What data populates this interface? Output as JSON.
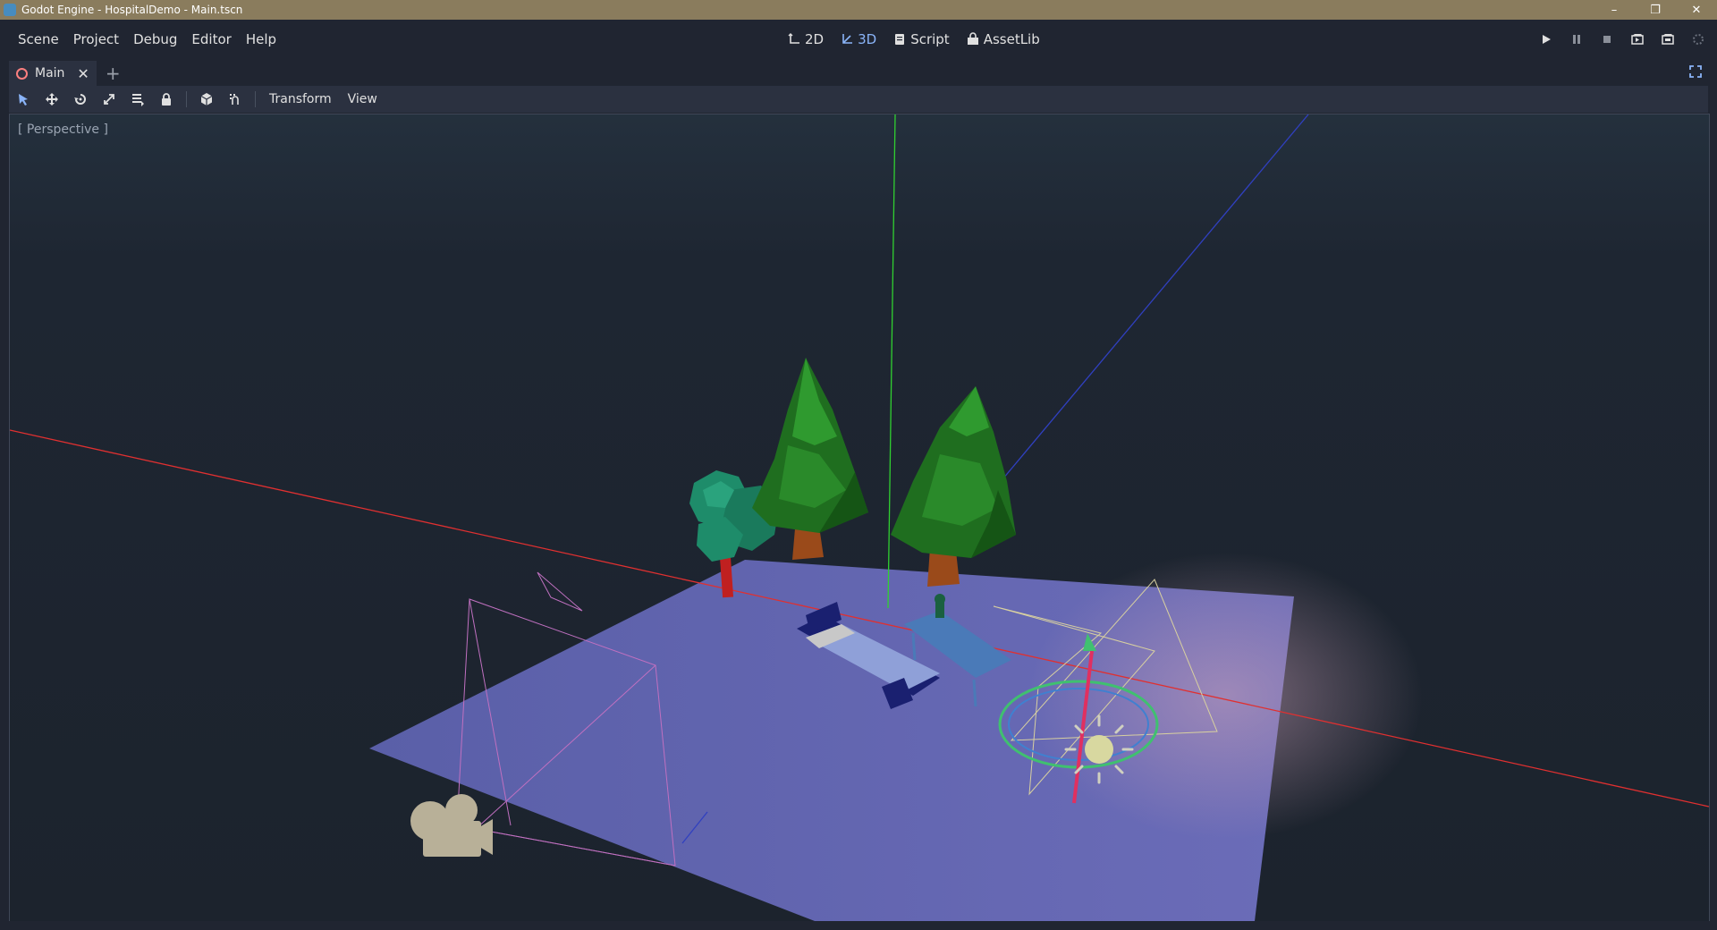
{
  "window": {
    "title": "Godot Engine - HospitalDemo - Main.tscn",
    "controls": [
      "minimize-icon",
      "restore-icon",
      "close-icon"
    ]
  },
  "menubar": {
    "menus": [
      "Scene",
      "Project",
      "Debug",
      "Editor",
      "Help"
    ],
    "workspaces": [
      {
        "label": "2D",
        "icon": "2d-icon",
        "active": false
      },
      {
        "label": "3D",
        "icon": "3d-icon",
        "active": true
      },
      {
        "label": "Script",
        "icon": "script-icon",
        "active": false
      },
      {
        "label": "AssetLib",
        "icon": "assetlib-icon",
        "active": false
      }
    ],
    "run_buttons": [
      "play-icon",
      "pause-icon",
      "stop-icon",
      "play-scene-icon",
      "play-custom-scene-icon",
      "spinner-icon"
    ]
  },
  "tabs": {
    "scenes": [
      {
        "label": "Main",
        "icon": "spatial-node-icon"
      }
    ],
    "add_icon": "plus-icon"
  },
  "viewport_toolbar": {
    "tools": [
      "select-icon",
      "move-icon",
      "rotate-icon",
      "scale-icon",
      "list-icon",
      "lock-icon",
      "local-space-icon",
      "snap-icon"
    ],
    "menus": [
      "Transform",
      "View"
    ]
  },
  "viewport": {
    "label": "[ Perspective ]",
    "objects": [
      "floor-plane",
      "pine-tree",
      "pine-tree",
      "round-tree",
      "hospital-bed",
      "table",
      "camera-gizmo",
      "light-gizmo"
    ]
  },
  "colors": {
    "accent": "#8ab4f8",
    "titlebar": "#8a7c5d",
    "background": "#202531",
    "x_axis": "#e03030",
    "y_axis": "#30d030",
    "z_axis": "#3040c0"
  }
}
